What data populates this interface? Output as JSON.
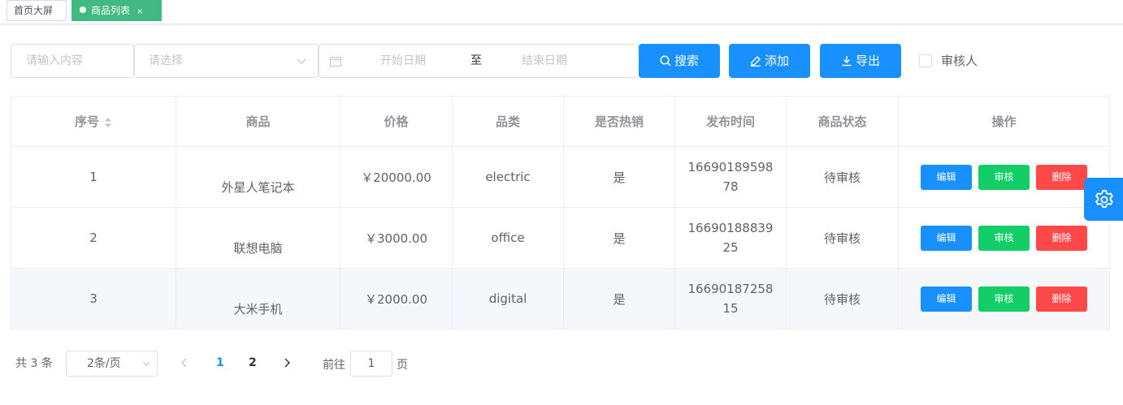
{
  "tags": [
    {
      "label": "首页大屏",
      "active": false
    },
    {
      "label": "商品列表",
      "active": true,
      "close": "×"
    }
  ],
  "filters": {
    "keyword_placeholder": "请输入内容",
    "select_placeholder": "请选择",
    "start_placeholder": "开始日期",
    "range_separator": "至",
    "end_placeholder": "结束日期",
    "search_label": "搜索",
    "add_label": "添加",
    "export_label": "导出",
    "reviewer_label": "审核人"
  },
  "table": {
    "headers": [
      "序号",
      "商品",
      "价格",
      "品类",
      "是否热销",
      "发布时间",
      "商品状态",
      "操作"
    ],
    "rows": [
      {
        "index": "1",
        "name": "外星人笔记本",
        "price": "￥20000.00",
        "category": "electric",
        "hot": "是",
        "time": "1669018959878",
        "status": "待审核"
      },
      {
        "index": "2",
        "name": "联想电脑",
        "price": "￥3000.00",
        "category": "office",
        "hot": "是",
        "time": "1669018883925",
        "status": "待审核"
      },
      {
        "index": "3",
        "name": "大米手机",
        "price": "￥2000.00",
        "category": "digital",
        "hot": "是",
        "time": "1669018725815",
        "status": "待审核"
      }
    ],
    "actions": {
      "edit": "编辑",
      "audit": "审核",
      "delete": "删除"
    }
  },
  "pagination": {
    "total": "共 3 条",
    "page_size": "2条/页",
    "pages": [
      "1",
      "2"
    ],
    "current": "1",
    "goto_prefix": "前往",
    "goto_value": "1",
    "goto_suffix": "页"
  },
  "colors": {
    "primary": "#1890ff",
    "success": "#13ce66",
    "danger": "#ff4949",
    "tag_active": "#42b983"
  }
}
